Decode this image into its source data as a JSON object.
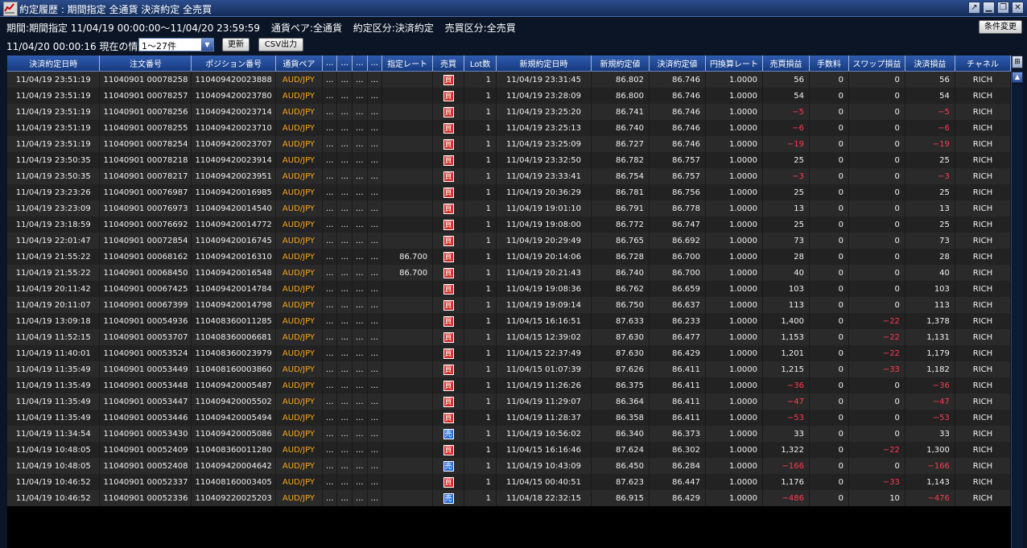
{
  "window": {
    "title": "約定履歴 : 期間指定 全通貨 決済約定 全売買"
  },
  "header": {
    "period": "期間:期間指定  11/04/19 00:00:00～11/04/20 23:59:59",
    "pair": "通貨ペア:全通貨",
    "exec_type": "約定区分:決済約定",
    "side": "売買区分:全売買",
    "current_info": "11/04/20 00:00:16 現在の情報",
    "range_select": "1〜27件",
    "refresh_label": "更新",
    "csv_label": "CSV出力",
    "condition_label": "条件変更"
  },
  "columns": [
    "決済約定日時",
    "注文番号",
    "ポジション番号",
    "通貨ペア",
    "...",
    "...",
    "...",
    "...",
    "指定レート",
    "売買",
    "Lot数",
    "新規約定日時",
    "新規約定値",
    "決済約定値",
    "円換算レート",
    "売買損益",
    "手数料",
    "スワップ損益",
    "決済損益",
    "チャネル"
  ],
  "rows": [
    [
      "11/04/19 23:51:19",
      "11040901 00078258",
      "110409420023888",
      "AUD/JPY",
      "...",
      "...",
      "...",
      "...",
      "",
      "買",
      "1",
      "11/04/19 23:31:45",
      "86.802",
      "86.746",
      "1.0000",
      "56",
      "0",
      "0",
      "56",
      "RICH"
    ],
    [
      "11/04/19 23:51:19",
      "11040901 00078257",
      "110409420023780",
      "AUD/JPY",
      "...",
      "...",
      "...",
      "...",
      "",
      "買",
      "1",
      "11/04/19 23:28:09",
      "86.800",
      "86.746",
      "1.0000",
      "54",
      "0",
      "0",
      "54",
      "RICH"
    ],
    [
      "11/04/19 23:51:19",
      "11040901 00078256",
      "110409420023714",
      "AUD/JPY",
      "...",
      "...",
      "...",
      "...",
      "",
      "買",
      "1",
      "11/04/19 23:25:20",
      "86.741",
      "86.746",
      "1.0000",
      "−5",
      "0",
      "0",
      "−5",
      "RICH"
    ],
    [
      "11/04/19 23:51:19",
      "11040901 00078255",
      "110409420023710",
      "AUD/JPY",
      "...",
      "...",
      "...",
      "...",
      "",
      "買",
      "1",
      "11/04/19 23:25:13",
      "86.740",
      "86.746",
      "1.0000",
      "−6",
      "0",
      "0",
      "−6",
      "RICH"
    ],
    [
      "11/04/19 23:51:19",
      "11040901 00078254",
      "110409420023707",
      "AUD/JPY",
      "...",
      "...",
      "...",
      "...",
      "",
      "買",
      "1",
      "11/04/19 23:25:09",
      "86.727",
      "86.746",
      "1.0000",
      "−19",
      "0",
      "0",
      "−19",
      "RICH"
    ],
    [
      "11/04/19 23:50:35",
      "11040901 00078218",
      "110409420023914",
      "AUD/JPY",
      "...",
      "...",
      "...",
      "...",
      "",
      "買",
      "1",
      "11/04/19 23:32:50",
      "86.782",
      "86.757",
      "1.0000",
      "25",
      "0",
      "0",
      "25",
      "RICH"
    ],
    [
      "11/04/19 23:50:35",
      "11040901 00078217",
      "110409420023951",
      "AUD/JPY",
      "...",
      "...",
      "...",
      "...",
      "",
      "買",
      "1",
      "11/04/19 23:33:41",
      "86.754",
      "86.757",
      "1.0000",
      "−3",
      "0",
      "0",
      "−3",
      "RICH"
    ],
    [
      "11/04/19 23:23:26",
      "11040901 00076987",
      "110409420016985",
      "AUD/JPY",
      "...",
      "...",
      "...",
      "...",
      "",
      "買",
      "1",
      "11/04/19 20:36:29",
      "86.781",
      "86.756",
      "1.0000",
      "25",
      "0",
      "0",
      "25",
      "RICH"
    ],
    [
      "11/04/19 23:23:09",
      "11040901 00076973",
      "110409420014540",
      "AUD/JPY",
      "...",
      "...",
      "...",
      "...",
      "",
      "買",
      "1",
      "11/04/19 19:01:10",
      "86.791",
      "86.778",
      "1.0000",
      "13",
      "0",
      "0",
      "13",
      "RICH"
    ],
    [
      "11/04/19 23:18:59",
      "11040901 00076692",
      "110409420014772",
      "AUD/JPY",
      "...",
      "...",
      "...",
      "...",
      "",
      "買",
      "1",
      "11/04/19 19:08:00",
      "86.772",
      "86.747",
      "1.0000",
      "25",
      "0",
      "0",
      "25",
      "RICH"
    ],
    [
      "11/04/19 22:01:47",
      "11040901 00072854",
      "110409420016745",
      "AUD/JPY",
      "...",
      "...",
      "...",
      "...",
      "",
      "買",
      "1",
      "11/04/19 20:29:49",
      "86.765",
      "86.692",
      "1.0000",
      "73",
      "0",
      "0",
      "73",
      "RICH"
    ],
    [
      "11/04/19 21:55:22",
      "11040901 00068162",
      "110409420016310",
      "AUD/JPY",
      "...",
      "...",
      "...",
      "...",
      "86.700",
      "買",
      "1",
      "11/04/19 20:14:06",
      "86.728",
      "86.700",
      "1.0000",
      "28",
      "0",
      "0",
      "28",
      "RICH"
    ],
    [
      "11/04/19 21:55:22",
      "11040901 00068450",
      "110409420016548",
      "AUD/JPY",
      "...",
      "...",
      "...",
      "...",
      "86.700",
      "買",
      "1",
      "11/04/19 20:21:43",
      "86.740",
      "86.700",
      "1.0000",
      "40",
      "0",
      "0",
      "40",
      "RICH"
    ],
    [
      "11/04/19 20:11:42",
      "11040901 00067425",
      "110409420014784",
      "AUD/JPY",
      "...",
      "...",
      "...",
      "...",
      "",
      "買",
      "1",
      "11/04/19 19:08:36",
      "86.762",
      "86.659",
      "1.0000",
      "103",
      "0",
      "0",
      "103",
      "RICH"
    ],
    [
      "11/04/19 20:11:07",
      "11040901 00067399",
      "110409420014798",
      "AUD/JPY",
      "...",
      "...",
      "...",
      "...",
      "",
      "買",
      "1",
      "11/04/19 19:09:14",
      "86.750",
      "86.637",
      "1.0000",
      "113",
      "0",
      "0",
      "113",
      "RICH"
    ],
    [
      "11/04/19 13:09:18",
      "11040901 00054936",
      "110408360011285",
      "AUD/JPY",
      "...",
      "...",
      "...",
      "...",
      "",
      "買",
      "1",
      "11/04/15 16:16:51",
      "87.633",
      "86.233",
      "1.0000",
      "1,400",
      "0",
      "−22",
      "1,378",
      "RICH"
    ],
    [
      "11/04/19 11:52:15",
      "11040901 00053707",
      "110408360006681",
      "AUD/JPY",
      "...",
      "...",
      "...",
      "...",
      "",
      "買",
      "1",
      "11/04/15 12:39:02",
      "87.630",
      "86.477",
      "1.0000",
      "1,153",
      "0",
      "−22",
      "1,131",
      "RICH"
    ],
    [
      "11/04/19 11:40:01",
      "11040901 00053524",
      "110408360023979",
      "AUD/JPY",
      "...",
      "...",
      "...",
      "...",
      "",
      "買",
      "1",
      "11/04/15 22:37:49",
      "87.630",
      "86.429",
      "1.0000",
      "1,201",
      "0",
      "−22",
      "1,179",
      "RICH"
    ],
    [
      "11/04/19 11:35:49",
      "11040901 00053449",
      "110408160003860",
      "AUD/JPY",
      "...",
      "...",
      "...",
      "...",
      "",
      "買",
      "1",
      "11/04/15 01:07:39",
      "87.626",
      "86.411",
      "1.0000",
      "1,215",
      "0",
      "−33",
      "1,182",
      "RICH"
    ],
    [
      "11/04/19 11:35:49",
      "11040901 00053448",
      "110409420005487",
      "AUD/JPY",
      "...",
      "...",
      "...",
      "...",
      "",
      "買",
      "1",
      "11/04/19 11:26:26",
      "86.375",
      "86.411",
      "1.0000",
      "−36",
      "0",
      "0",
      "−36",
      "RICH"
    ],
    [
      "11/04/19 11:35:49",
      "11040901 00053447",
      "110409420005502",
      "AUD/JPY",
      "...",
      "...",
      "...",
      "...",
      "",
      "買",
      "1",
      "11/04/19 11:29:07",
      "86.364",
      "86.411",
      "1.0000",
      "−47",
      "0",
      "0",
      "−47",
      "RICH"
    ],
    [
      "11/04/19 11:35:49",
      "11040901 00053446",
      "110409420005494",
      "AUD/JPY",
      "...",
      "...",
      "...",
      "...",
      "",
      "買",
      "1",
      "11/04/19 11:28:37",
      "86.358",
      "86.411",
      "1.0000",
      "−53",
      "0",
      "0",
      "−53",
      "RICH"
    ],
    [
      "11/04/19 11:34:54",
      "11040901 00053430",
      "110409420005086",
      "AUD/JPY",
      "...",
      "...",
      "...",
      "...",
      "",
      "売",
      "1",
      "11/04/19 10:56:02",
      "86.340",
      "86.373",
      "1.0000",
      "33",
      "0",
      "0",
      "33",
      "RICH"
    ],
    [
      "11/04/19 10:48:05",
      "11040901 00052409",
      "110408360011280",
      "AUD/JPY",
      "...",
      "...",
      "...",
      "...",
      "",
      "買",
      "1",
      "11/04/15 16:16:46",
      "87.624",
      "86.302",
      "1.0000",
      "1,322",
      "0",
      "−22",
      "1,300",
      "RICH"
    ],
    [
      "11/04/19 10:48:05",
      "11040901 00052408",
      "110409420004642",
      "AUD/JPY",
      "...",
      "...",
      "...",
      "...",
      "",
      "売",
      "1",
      "11/04/19 10:43:09",
      "86.450",
      "86.284",
      "1.0000",
      "−166",
      "0",
      "0",
      "−166",
      "RICH"
    ],
    [
      "11/04/19 10:46:52",
      "11040901 00052337",
      "110408160003405",
      "AUD/JPY",
      "...",
      "...",
      "...",
      "...",
      "",
      "買",
      "1",
      "11/04/15 00:40:51",
      "87.623",
      "86.447",
      "1.0000",
      "1,176",
      "0",
      "−33",
      "1,143",
      "RICH"
    ],
    [
      "11/04/19 10:46:52",
      "11040901 00052336",
      "110409220025203",
      "AUD/JPY",
      "...",
      "...",
      "...",
      "...",
      "",
      "売",
      "1",
      "11/04/18 22:32:15",
      "86.915",
      "86.429",
      "1.0000",
      "−486",
      "0",
      "10",
      "−476",
      "RICH"
    ]
  ],
  "colors": {
    "negative": "#ff3a4e",
    "pair": "#ffa31a",
    "buy": "#d92b2b",
    "sell": "#2a6fd6",
    "header": "#1f4894"
  },
  "icons": {
    "app": "chart-icon",
    "scroll_up": "arrow-up-icon"
  }
}
